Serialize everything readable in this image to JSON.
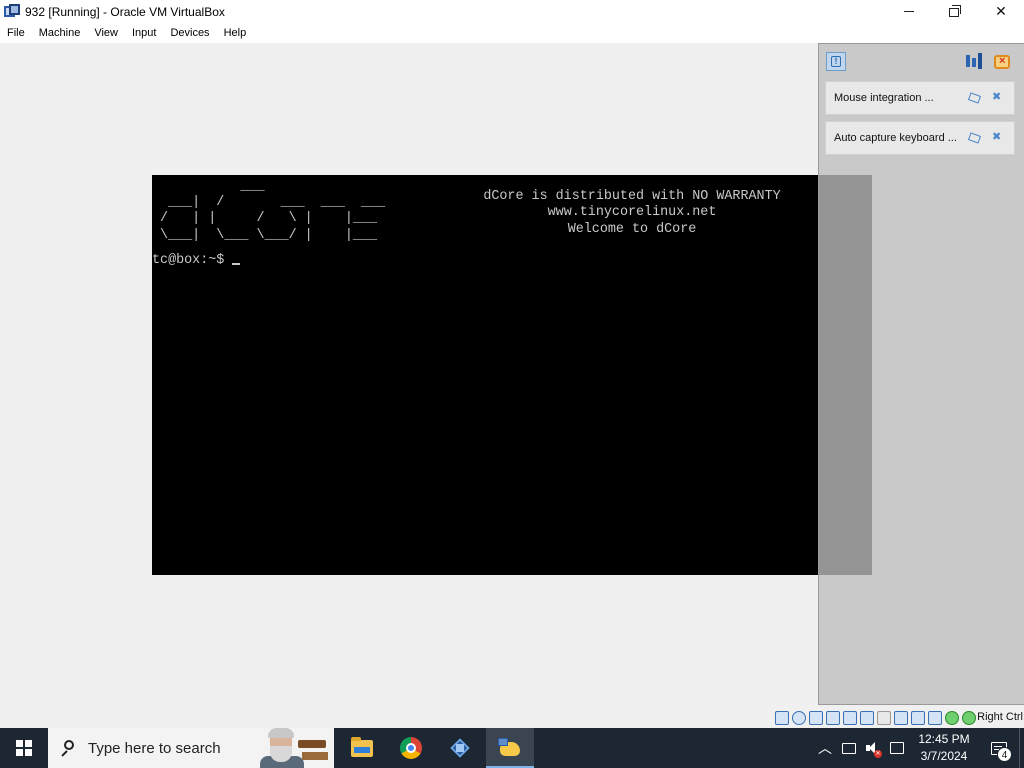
{
  "window": {
    "title": "932 [Running] - Oracle VM VirtualBox",
    "controls": [
      "minimize-icon",
      "maximize-icon",
      "close-icon"
    ]
  },
  "menubar": {
    "items": [
      "File",
      "Machine",
      "View",
      "Input",
      "Devices",
      "Help"
    ]
  },
  "vm": {
    "logo_lines": [
      "           ___",
      "  ___|  /       ___  ___  ___",
      " /   | |     /   \\ |    |___",
      " \\___|  \\___ \\___/ |    |___"
    ],
    "banner": [
      "dCore is distributed with NO WARRANTY",
      "www.tinycorelinux.net",
      "Welcome to dCore"
    ],
    "prompt": "tc@box:~$",
    "console_fg": "#c8c8c8",
    "console_bg": "#000000"
  },
  "notifications": {
    "header_icons": [
      "info-icon",
      "sort-icon",
      "dismiss-all-icon"
    ],
    "items": [
      {
        "text": "Mouse integration ..."
      },
      {
        "text": "Auto capture keyboard ..."
      }
    ]
  },
  "vm_status": {
    "host_key": "Right Ctrl",
    "icons": [
      "hard-disk-icon",
      "optical-drive-icon",
      "audio-icon",
      "network-icon",
      "usb-icon",
      "shared-folders-icon",
      "display-icon",
      "recording-icon",
      "vm-icon",
      "vm-running-icon",
      "mouse-integration-icon",
      "keyboard-capture-icon"
    ]
  },
  "taskbar": {
    "search_placeholder": "Type here to search",
    "apps": [
      "file-explorer",
      "google-chrome",
      "virtualbox-manager",
      "dcore-vm"
    ],
    "clock_time": "12:45 PM",
    "clock_date": "3/7/2024",
    "notification_count": "4"
  },
  "colors": {
    "taskbar_bg": "#1d2733",
    "accent": "#7fb2e5"
  }
}
